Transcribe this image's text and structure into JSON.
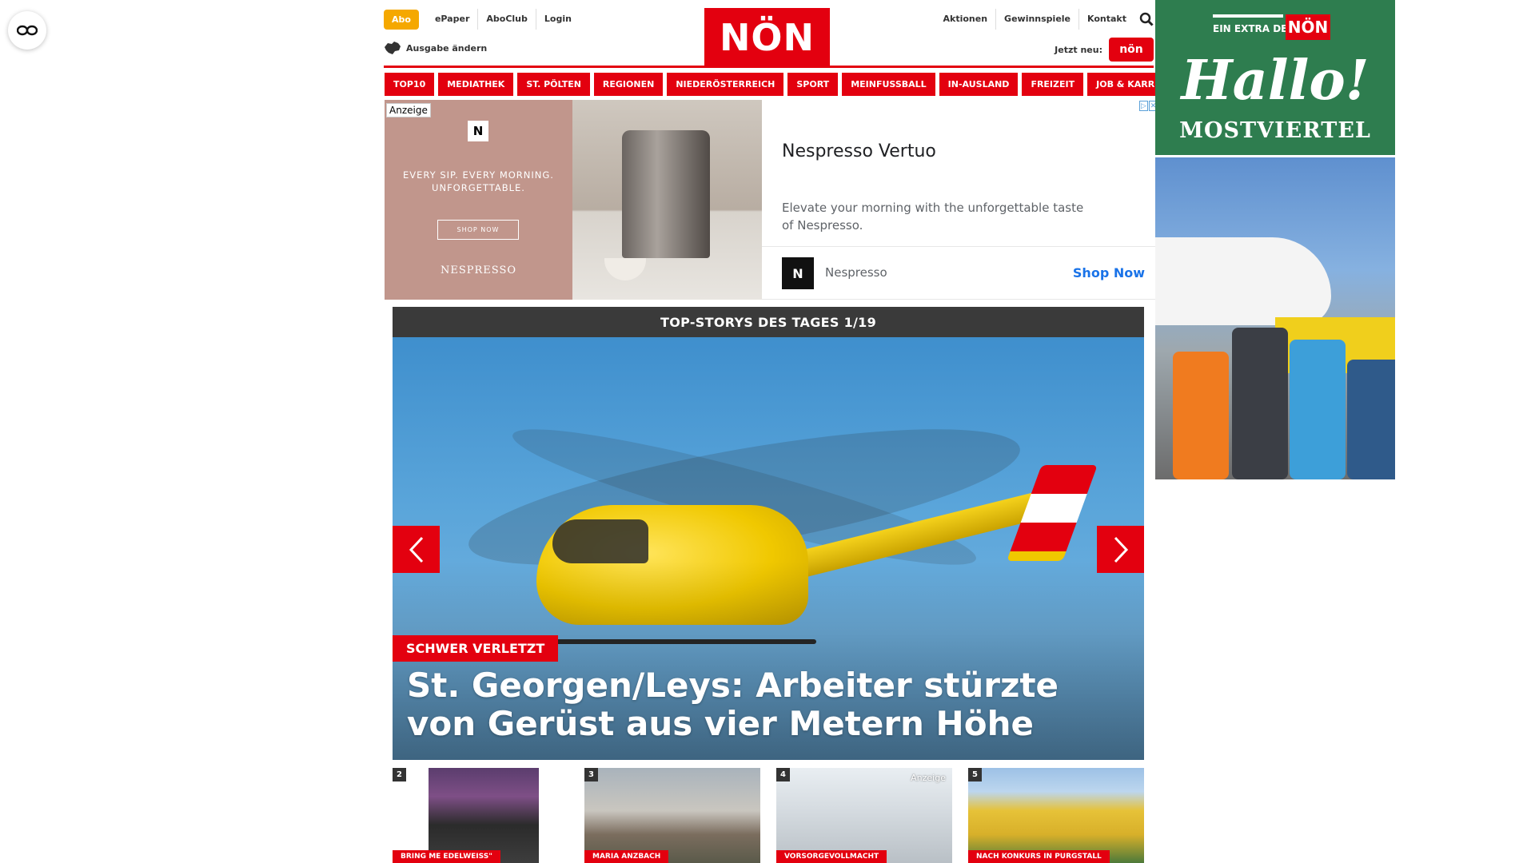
{
  "header": {
    "abo_label": "Abo",
    "top_links": [
      "ePaper",
      "AboClub",
      "Login"
    ],
    "edition_label": "Ausgabe ändern",
    "logo_text": "NÖN",
    "right_links": [
      "Aktionen",
      "Gewinnspiele",
      "Kontakt"
    ],
    "jetzt_label": "Jetzt neu:",
    "jetzt_logo": "nön"
  },
  "nav": {
    "items": [
      "TOP10",
      "MEDIATHEK",
      "ST. PÖLTEN",
      "REGIONEN",
      "NIEDERÖSTERREICH",
      "SPORT",
      "MEINFUSSBALL",
      "IN-AUSLAND",
      "FREIZEIT",
      "JOB & KARRIERE"
    ]
  },
  "ad": {
    "label": "Anzeige",
    "logo_letter": "N",
    "slogan": "EVERY SIP. EVERY MORNING. UNFORGETTABLE.",
    "shop_button": "SHOP NOW",
    "brand_mark": "NESPRESSO",
    "title": "Nespresso Vertuo",
    "description": "Elevate your morning with the unforgettable taste of Nespresso.",
    "advertiser": "Nespresso",
    "cta": "Shop Now"
  },
  "stories": {
    "header": "TOP-STORYS DES TAGES 1/19",
    "hero_tag": "SCHWER VERLETZT",
    "hero_title": "St. Georgen/Leys: Arbeiter stürzte von Gerüst aus vier Metern Höhe",
    "thumbs": [
      {
        "num": "2",
        "category": "BRING ME EDELWEISS\"",
        "anzeige": ""
      },
      {
        "num": "3",
        "category": "MARIA ANZBACH",
        "anzeige": ""
      },
      {
        "num": "4",
        "category": "VORSORGEVOLLMACHT",
        "anzeige": "Anzeige"
      },
      {
        "num": "5",
        "category": "NACH KONKURS IN PURGSTALL",
        "anzeige": ""
      }
    ]
  },
  "side_ad": {
    "extra_text": "EIN EXTRA DER",
    "extra_logo": "NÖN",
    "headline": "Hallo!",
    "region": "MOSTVIERTEL"
  },
  "colors": {
    "brand_red": "#e3000f",
    "abo_orange": "#f5a800",
    "stories_bar": "#3a3a3a",
    "side_green": "#2e7d4f"
  }
}
